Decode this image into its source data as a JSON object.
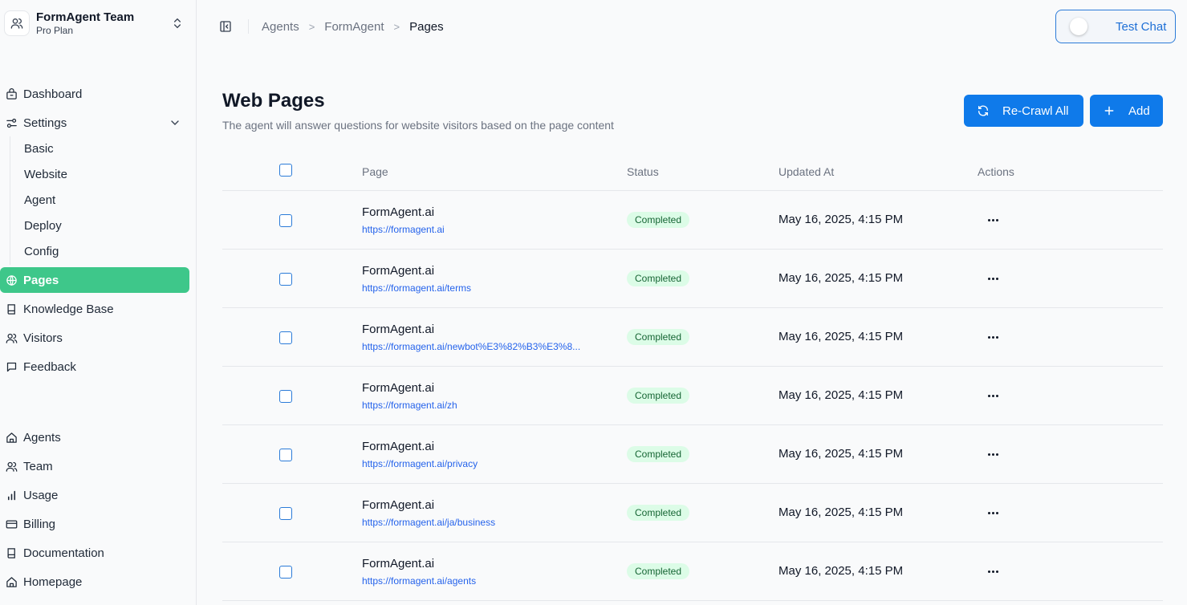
{
  "team": {
    "name": "FormAgent Team",
    "plan": "Pro Plan"
  },
  "sidebar": {
    "items": [
      {
        "label": "Dashboard",
        "icon": "dashboard-icon"
      },
      {
        "label": "Settings",
        "icon": "settings-sliders-icon"
      },
      {
        "label": "Pages",
        "icon": "globe-icon",
        "active": true
      },
      {
        "label": "Knowledge Base",
        "icon": "book-icon"
      },
      {
        "label": "Visitors",
        "icon": "users-icon"
      },
      {
        "label": "Feedback",
        "icon": "message-icon"
      }
    ],
    "settings_sub": [
      "Basic",
      "Website",
      "Agent",
      "Deploy",
      "Config"
    ],
    "bottom_items": [
      {
        "label": "Agents",
        "icon": "home-icon"
      },
      {
        "label": "Team",
        "icon": "users-icon"
      },
      {
        "label": "Usage",
        "icon": "bar-chart-icon"
      },
      {
        "label": "Billing",
        "icon": "credit-card-icon"
      },
      {
        "label": "Documentation",
        "icon": "book-icon"
      },
      {
        "label": "Homepage",
        "icon": "home-icon"
      }
    ]
  },
  "breadcrumb": [
    "Agents",
    "FormAgent",
    "Pages"
  ],
  "header": {
    "test_chat": "Test Chat"
  },
  "page": {
    "title": "Web Pages",
    "description": "The agent will answer questions for website visitors based on the page content",
    "recrawl_label": "Re-Crawl All",
    "add_label": "Add"
  },
  "table": {
    "headers": [
      "Page",
      "Status",
      "Updated At",
      "Actions"
    ],
    "rows": [
      {
        "title": "FormAgent.ai",
        "url": "https://formagent.ai",
        "status": "Completed",
        "updated": "May 16, 2025, 4:15 PM"
      },
      {
        "title": "FormAgent.ai",
        "url": "https://formagent.ai/terms",
        "status": "Completed",
        "updated": "May 16, 2025, 4:15 PM"
      },
      {
        "title": "FormAgent.ai",
        "url": "https://formagent.ai/newbot%E3%82%B3%E3%8...",
        "status": "Completed",
        "updated": "May 16, 2025, 4:15 PM"
      },
      {
        "title": "FormAgent.ai",
        "url": "https://formagent.ai/zh",
        "status": "Completed",
        "updated": "May 16, 2025, 4:15 PM"
      },
      {
        "title": "FormAgent.ai",
        "url": "https://formagent.ai/privacy",
        "status": "Completed",
        "updated": "May 16, 2025, 4:15 PM"
      },
      {
        "title": "FormAgent.ai",
        "url": "https://formagent.ai/ja/business",
        "status": "Completed",
        "updated": "May 16, 2025, 4:15 PM"
      },
      {
        "title": "FormAgent.ai",
        "url": "https://formagent.ai/agents",
        "status": "Completed",
        "updated": "May 16, 2025, 4:15 PM"
      }
    ]
  },
  "colors": {
    "accent": "#0f7aea",
    "active_nav": "#3ec78a",
    "status_bg": "#dcfce7",
    "status_text": "#166534"
  }
}
